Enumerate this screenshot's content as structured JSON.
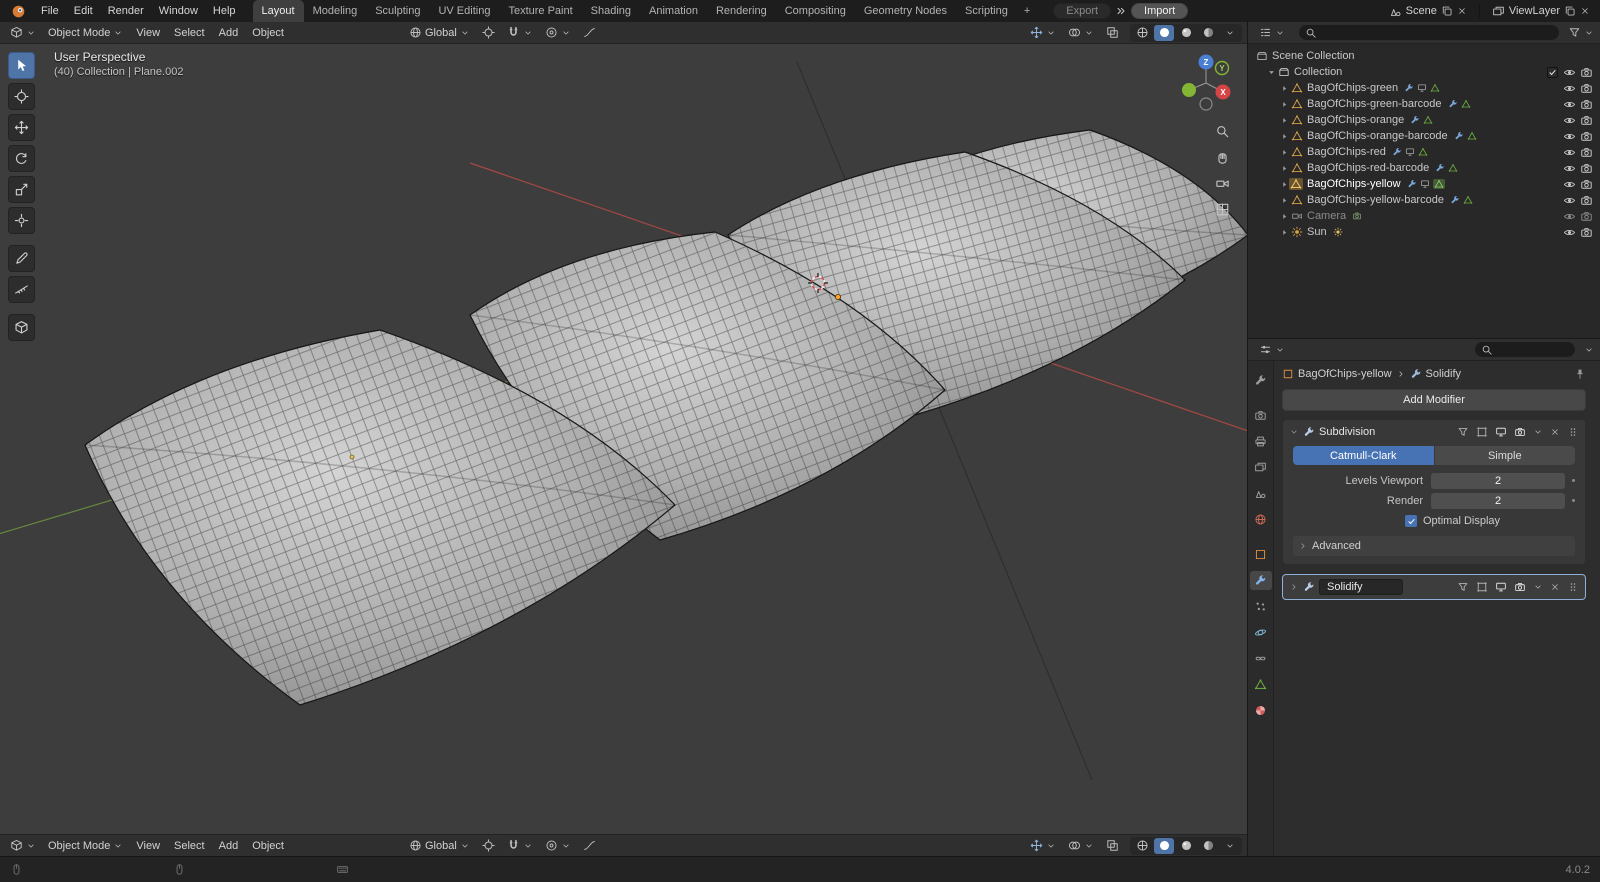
{
  "topbar": {
    "menus": [
      "File",
      "Edit",
      "Render",
      "Window",
      "Help"
    ],
    "workspaces": [
      "Layout",
      "Modeling",
      "Sculpting",
      "UV Editing",
      "Texture Paint",
      "Shading",
      "Animation",
      "Rendering",
      "Compositing",
      "Geometry Nodes",
      "Scripting"
    ],
    "active_workspace": "Layout",
    "add_workspace": "+",
    "export_button": "Export",
    "import_button": "Import",
    "scene": {
      "label": "Scene"
    },
    "view_layer": {
      "label": "ViewLayer"
    }
  },
  "viewport": {
    "header": {
      "mode": "Object Mode",
      "menu_view": "View",
      "menu_select": "Select",
      "menu_add": "Add",
      "menu_object": "Object",
      "orientation": "Global"
    },
    "overlay": {
      "line1": "User Perspective",
      "line2": "(40) Collection | Plane.002"
    },
    "axis_gizmo": {
      "x": "X",
      "y": "Y",
      "z": "Z"
    }
  },
  "outliner": {
    "root": "Scene Collection",
    "collection": "Collection",
    "items": [
      {
        "label": "BagOfChips-green",
        "kind": "mesh"
      },
      {
        "label": "BagOfChips-green-barcode",
        "kind": "mesh"
      },
      {
        "label": "BagOfChips-orange",
        "kind": "mesh"
      },
      {
        "label": "BagOfChips-orange-barcode",
        "kind": "mesh"
      },
      {
        "label": "BagOfChips-red",
        "kind": "mesh"
      },
      {
        "label": "BagOfChips-red-barcode",
        "kind": "mesh"
      },
      {
        "label": "BagOfChips-yellow",
        "kind": "mesh",
        "selected": true
      },
      {
        "label": "BagOfChips-yellow-barcode",
        "kind": "mesh"
      },
      {
        "label": "Camera",
        "kind": "camera"
      },
      {
        "label": "Sun",
        "kind": "light"
      }
    ]
  },
  "properties": {
    "breadcrumb": {
      "object": "BagOfChips-yellow",
      "modifier": "Solidify"
    },
    "add_modifier_label": "Add Modifier",
    "modifiers": {
      "subdivision": {
        "name": "Subdivision",
        "types": [
          "Catmull-Clark",
          "Simple"
        ],
        "active_type": "Catmull-Clark",
        "rows": [
          {
            "label": "Levels Viewport",
            "value": "2"
          },
          {
            "label": "Render",
            "value": "2"
          }
        ],
        "optimal_display_label": "Optimal Display",
        "optimal_display_checked": true,
        "advanced_label": "Advanced"
      },
      "solidify": {
        "name": "Solidify"
      }
    }
  },
  "status_bar": {
    "version": "4.0.2"
  },
  "colors": {
    "accent": "#4772b3",
    "object_orange": "#dd8d3e",
    "mesh_green": "#6db33f",
    "modifier_blue": "#79b1e8",
    "axis_x": "#d64545",
    "axis_y": "#83b634",
    "axis_z": "#4a7fd6"
  }
}
